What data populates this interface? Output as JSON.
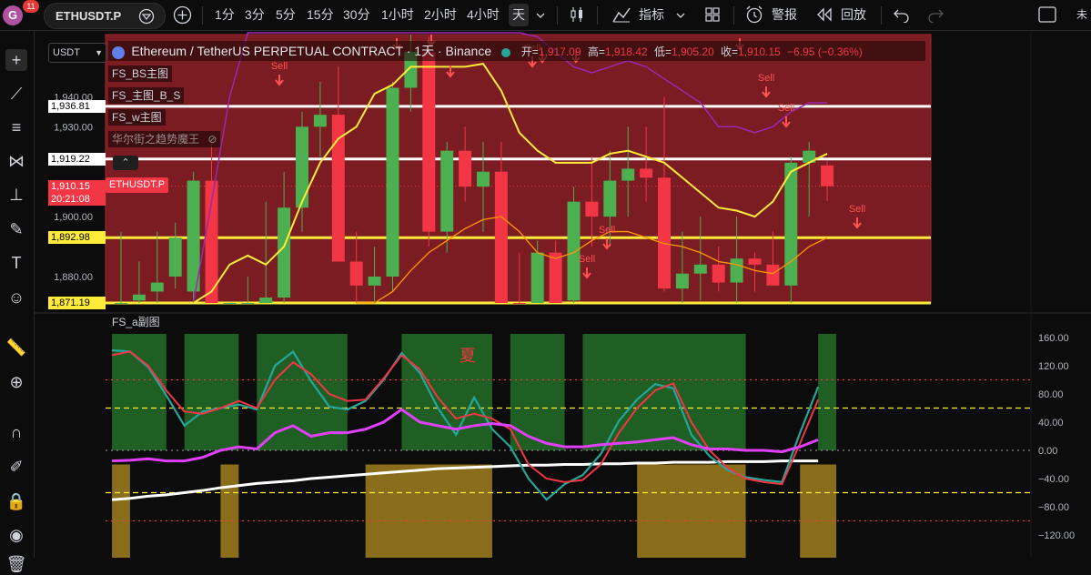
{
  "topbar": {
    "avatar_letter": "G",
    "badge_count": "11",
    "symbol": "ETHUSDT.P",
    "intervals": [
      "1分",
      "3分",
      "5分",
      "15分",
      "30分",
      "1小时",
      "2小时",
      "4小时",
      "天"
    ],
    "indicators_label": "指标",
    "alert_label": "警报",
    "replay_label": "回放",
    "right_text": "未"
  },
  "chart": {
    "currency": "USDT",
    "title": "Ethereum / TetherUS PERPETUAL CONTRACT · 1天 · Binance",
    "ohlc": {
      "open_label": "开=",
      "open": "1,917.09",
      "high_label": "高=",
      "high": "1,918.42",
      "low_label": "低=",
      "low": "1,905.20",
      "close_label": "收=",
      "close": "1,910.15",
      "change": "−6.95 (−0.36%)"
    },
    "legends": [
      "FS_BS主图",
      "FS_主图_B_S",
      "FS_w主图",
      "华尔街之趋势魔王"
    ],
    "sub_legend": "FS_a副图",
    "symbol_tag": "ETHUSDT.P",
    "price_labels": [
      {
        "text": "1,940.00",
        "price": 1940
      },
      {
        "text": "1,930.00",
        "price": 1930
      },
      {
        "text": "1,900.00",
        "price": 1900
      },
      {
        "text": "1,880.00",
        "price": 1880
      }
    ],
    "hlines": [
      {
        "text": "1,936.81",
        "price": 1936.81,
        "color": "#ffffff",
        "bg": "#ffffff",
        "fg": "#000000"
      },
      {
        "text": "1,919.22",
        "price": 1919.22,
        "color": "#ffffff",
        "bg": "#ffffff",
        "fg": "#000000"
      },
      {
        "text": "1,892.98",
        "price": 1892.98,
        "color": "#ffeb3b",
        "bg": "#ffeb3b",
        "fg": "#000000"
      },
      {
        "text": "1,871.19",
        "price": 1871.19,
        "color": "#ffeb3b",
        "bg": "#ffeb3b",
        "fg": "#000000"
      }
    ],
    "current_price": {
      "text": "1,910.15",
      "countdown": "20:21:08",
      "price": 1910.15
    },
    "sell_label": "Sell",
    "season_label": "夏",
    "osc_labels": [
      "160.00",
      "120.00",
      "80.00",
      "40.00",
      "0.00",
      "−40.00",
      "−80.00",
      "−120.00"
    ],
    "colors": {
      "up": "#4caf50",
      "down": "#f23645",
      "bg_red": "#7a1c22",
      "ma_yellow": "#ffeb3b",
      "ma_purple": "#9c27b0",
      "ma_orange": "#ff9800"
    }
  }
}
